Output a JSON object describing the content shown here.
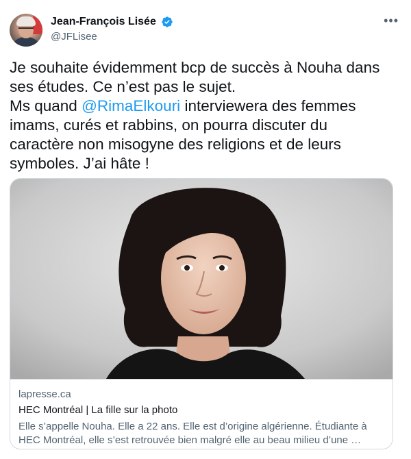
{
  "author": {
    "display_name": "Jean-François Lisée",
    "handle": "@JFLisee",
    "verified": true,
    "avatar_icon": "profile-photo"
  },
  "more_icon": "more-horizontal-icon",
  "tweet": {
    "text_before_mention": "Je souhaite évidemment bcp de succès à Nouha dans\nses études. Ce n’est pas le sujet.\nMs quand ",
    "mention": "@RimaElkouri",
    "text_after_mention": " interviewera des femmes\nimams, curés et rabbins, on pourra discuter du\ncaractère non misogyne des religions et de leurs\nsymboles. J’ai hâte !"
  },
  "card": {
    "image_alt": "portrait photo of a woman",
    "domain": "lapresse.ca",
    "title": "HEC Montréal | La fille sur la photo",
    "description": "Elle s’appelle Nouha. Elle a 22 ans. Elle est d’origine algérienne. Étudiante à\nHEC Montréal, elle s’est retrouvée bien malgré elle au beau milieu d’une …"
  },
  "colors": {
    "link": "#1d9bf0",
    "verified_badge": "#1d9bf0",
    "secondary_text": "#536471",
    "border": "#cfd9de"
  }
}
